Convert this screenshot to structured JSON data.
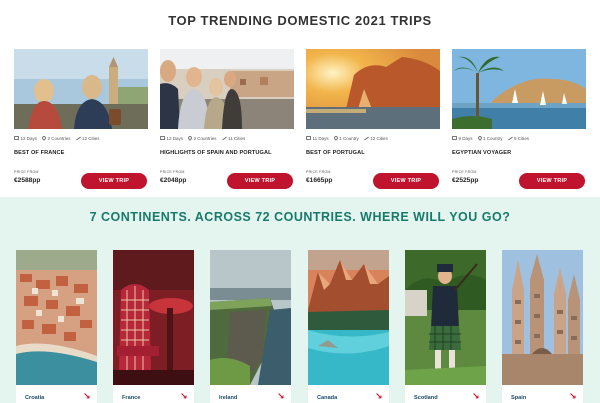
{
  "trips": {
    "title": "TOP TRENDING DOMESTIC 2021 TRIPS",
    "items": [
      {
        "name": "BEST OF FRANCE",
        "days": "12 Days",
        "countries": "2 Countries",
        "cities": "12 Cities",
        "price_from": "PRICE FROM",
        "price": "€2588pp",
        "button": "VIEW TRIP"
      },
      {
        "name": "HIGHLIGHTS OF SPAIN AND PORTUGAL",
        "days": "12 Days",
        "countries": "2 Countries",
        "cities": "11 Cities",
        "price_from": "PRICE FROM",
        "price": "€2048pp",
        "button": "VIEW TRIP"
      },
      {
        "name": "BEST OF PORTUGAL",
        "days": "11 Days",
        "countries": "1 Country",
        "cities": "12 Cities",
        "price_from": "PRICE FROM",
        "price": "€1665pp",
        "button": "VIEW TRIP"
      },
      {
        "name": "EGYPTIAN VOYAGER",
        "days": "9 Days",
        "countries": "1 Country",
        "cities": "5 Cities",
        "price_from": "PRICE FROM",
        "price": "€2525pp",
        "button": "VIEW TRIP"
      }
    ]
  },
  "continents": {
    "title": "7 CONTINENTS. ACROSS 72 COUNTRIES. WHERE WILL YOU GO?",
    "destinations": [
      {
        "name": "Croatia"
      },
      {
        "name": "France"
      },
      {
        "name": "Ireland"
      },
      {
        "name": "Canada"
      },
      {
        "name": "Scotland"
      },
      {
        "name": "Spain"
      }
    ],
    "arrow_glyph": "↘"
  },
  "colors": {
    "accent": "#c0132d",
    "heading_teal": "#187a6a",
    "band_bg": "#e4f4ef"
  }
}
